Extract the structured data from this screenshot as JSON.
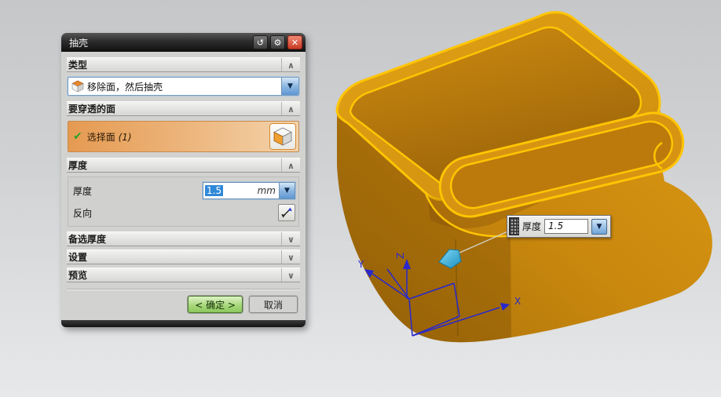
{
  "dialog": {
    "title": "抽壳",
    "type_section": {
      "label": "类型",
      "chevron": "∧"
    },
    "type_value": "移除面，然后抽壳",
    "faces_section": {
      "label": "要穿透的面",
      "chevron": "∧"
    },
    "selection_text": "选择面",
    "selection_count": "(1)",
    "thickness_section": {
      "label": "厚度",
      "chevron": "∧"
    },
    "thickness_label": "厚度",
    "thickness_value": "1.5",
    "thickness_unit": "mm",
    "reverse_label": "反向",
    "alt_thickness_section": {
      "label": "备选厚度",
      "chevron": "∨"
    },
    "settings_section": {
      "label": "设置",
      "chevron": "∨"
    },
    "preview_section": {
      "label": "预览",
      "chevron": "∨"
    },
    "ok_label": "< 确定 >",
    "cancel_label": "取消"
  },
  "icons": {
    "reset": "↺",
    "gear": "⚙",
    "close": "✕",
    "dropdown_arrow": "▼",
    "check": "✔"
  },
  "viewport": {
    "floating_label": "厚度",
    "floating_value": "1.5",
    "axis_x": "X",
    "axis_y": "Y",
    "axis_z": "Z"
  },
  "colors": {
    "model_body": "#c9880e",
    "edge_highlight": "#ffc503",
    "axis_blue": "#2828cc",
    "direction_arrow": "#2fb3e6",
    "selection_highlight": "#e59a51",
    "ok_green": "#8cc85e"
  }
}
